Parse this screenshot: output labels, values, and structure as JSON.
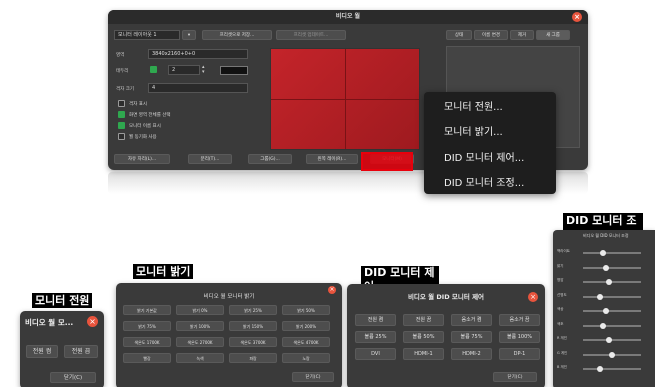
{
  "main_window": {
    "title": "비디오 월",
    "monitor_select": "모니터 레이아웃 1",
    "toolbar_btn_1": "프리셋으로 저장...",
    "toolbar_btn_2": "프리셋 업데이트...",
    "right_tabs": [
      "상태",
      "이름 변경",
      "제거",
      "새 그룹"
    ],
    "area_label": "영역",
    "area_value": "3840x2160+0+0",
    "bezel_label": "테두리",
    "bezel_value": "2",
    "color_label": "격자 크기",
    "color_value": "4",
    "checkboxes": [
      "격자 표시",
      "화면 영역 전체를 선택",
      "모니터 이름 표시",
      "월 동기화 사용"
    ],
    "bottom_buttons": [
      "자유 자리(L)...",
      "분리(T)...",
      "그룹(G)...",
      "왼쪽 레이(R)...",
      "모니터(M)"
    ],
    "highlight_color": "#e8000c"
  },
  "context_menu": {
    "items": [
      "모니터 전원...",
      "모니터 밝기...",
      "DID 모니터 제어...",
      "DID 모니터 조정..."
    ]
  },
  "captions": {
    "power": "모니터 전원",
    "brightness": "모니터 밝기",
    "did_control": "DID 모니터 제어",
    "did_adjust": "DID 모니터 조정"
  },
  "power_dialog": {
    "title": "비디오 월 모...",
    "buttons": [
      "전원 켬",
      "전원 끔"
    ],
    "close": "닫기(C)"
  },
  "brightness_dialog": {
    "title": "비디오 월 모니터 밝기",
    "buttons": [
      "밝기 기본값",
      "밝기 0%",
      "밝기 25%",
      "밝기 50%",
      "밝기 75%",
      "밝기 100%",
      "밝기 150%",
      "밝기 200%",
      "색온도 1700K",
      "색온도 2700K",
      "색온도 3700K",
      "색온도 4700K",
      "빨강",
      "녹색",
      "파랑",
      "노랑"
    ],
    "close": "닫기(C)"
  },
  "did_control_dialog": {
    "title": "비디오 월 DID 모니터 제어",
    "buttons": [
      "전원 켬",
      "전원 끔",
      "음소거 켬",
      "음소거 끔",
      "볼륨 25%",
      "볼륨 50%",
      "볼륨 75%",
      "볼륨 100%",
      "DVI",
      "HDMI-1",
      "HDMI-2",
      "DP-1"
    ],
    "close": "닫기(C)"
  },
  "did_adjust_dialog": {
    "title": "비디오 월 DID 모니터 조정",
    "slider_labels": [
      "백라이트",
      "밝기",
      "명암",
      "선명도",
      "색상",
      "색조",
      "R 게인",
      "G 게인",
      "B 게인"
    ],
    "slider_levels": [
      0.35,
      0.4,
      0.45,
      0.3,
      0.4,
      0.35,
      0.45,
      0.5,
      0.3
    ]
  }
}
